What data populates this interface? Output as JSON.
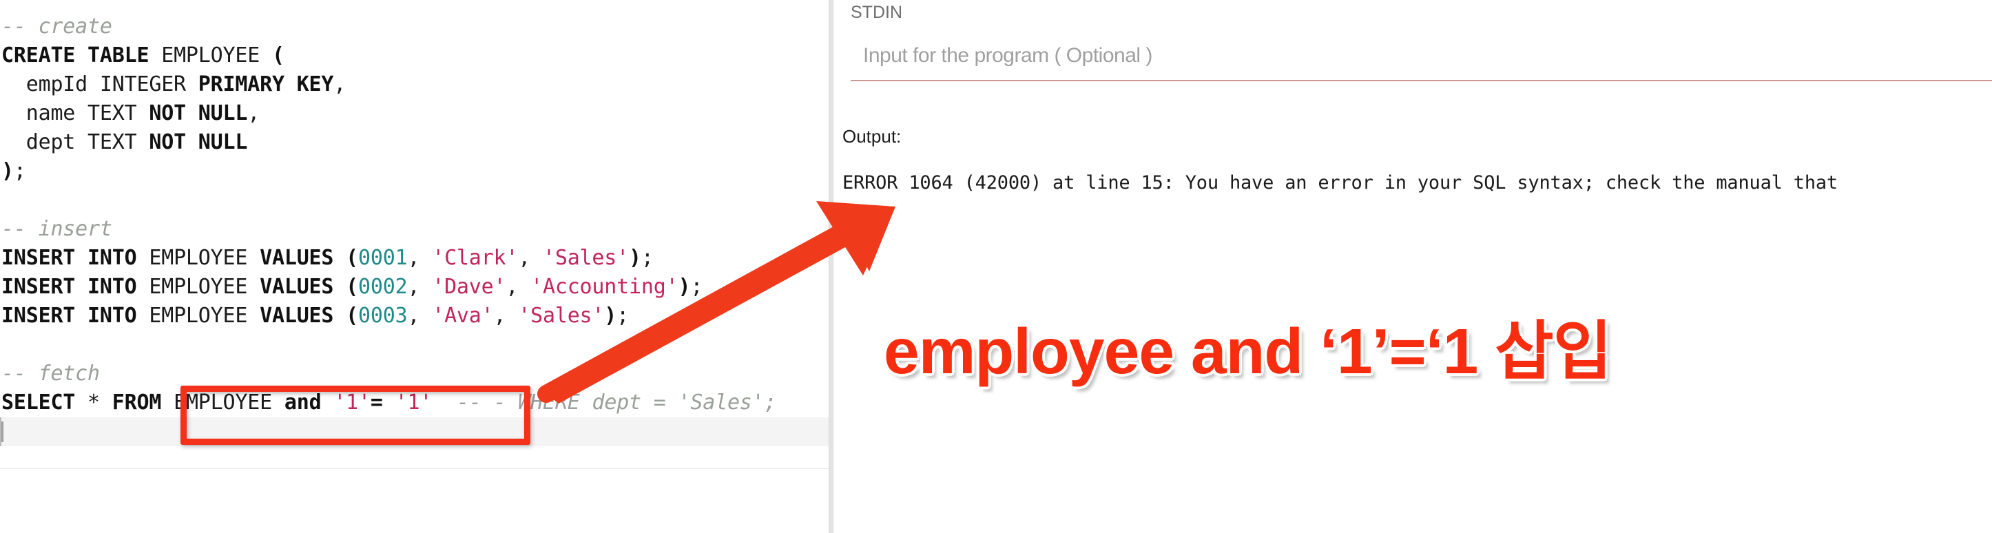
{
  "editor": {
    "lines": [
      {
        "id": "line-comment-create",
        "tokens": [
          {
            "t": "comment",
            "v": "-- create"
          }
        ]
      },
      {
        "id": "line-create-table",
        "tokens": [
          {
            "t": "kw",
            "v": "CREATE TABLE"
          },
          {
            "t": "plain",
            "v": " EMPLOYEE "
          },
          {
            "t": "kw",
            "v": "("
          }
        ]
      },
      {
        "id": "line-col-empid",
        "tokens": [
          {
            "t": "plain",
            "v": "  empId INTEGER "
          },
          {
            "t": "kw",
            "v": "PRIMARY KEY"
          },
          {
            "t": "plain",
            "v": ","
          }
        ]
      },
      {
        "id": "line-col-name",
        "tokens": [
          {
            "t": "plain",
            "v": "  name TEXT "
          },
          {
            "t": "kw",
            "v": "NOT NULL"
          },
          {
            "t": "plain",
            "v": ","
          }
        ]
      },
      {
        "id": "line-col-dept",
        "tokens": [
          {
            "t": "plain",
            "v": "  dept TEXT "
          },
          {
            "t": "kw",
            "v": "NOT NULL"
          }
        ]
      },
      {
        "id": "line-close-paren",
        "tokens": [
          {
            "t": "kw",
            "v": ")"
          },
          {
            "t": "plain",
            "v": ";"
          }
        ]
      },
      {
        "id": "line-blank-1",
        "tokens": [
          {
            "t": "plain",
            "v": " "
          }
        ]
      },
      {
        "id": "line-comment-insert",
        "tokens": [
          {
            "t": "comment",
            "v": "-- insert"
          }
        ]
      },
      {
        "id": "line-insert-1",
        "tokens": [
          {
            "t": "kw",
            "v": "INSERT INTO"
          },
          {
            "t": "plain",
            "v": " EMPLOYEE "
          },
          {
            "t": "kw",
            "v": "VALUES ("
          },
          {
            "t": "num",
            "v": "0001"
          },
          {
            "t": "plain",
            "v": ", "
          },
          {
            "t": "str",
            "v": "'Clark'"
          },
          {
            "t": "plain",
            "v": ", "
          },
          {
            "t": "str",
            "v": "'Sales'"
          },
          {
            "t": "kw",
            "v": ")"
          },
          {
            "t": "plain",
            "v": ";"
          }
        ]
      },
      {
        "id": "line-insert-2",
        "tokens": [
          {
            "t": "kw",
            "v": "INSERT INTO"
          },
          {
            "t": "plain",
            "v": " EMPLOYEE "
          },
          {
            "t": "kw",
            "v": "VALUES ("
          },
          {
            "t": "num",
            "v": "0002"
          },
          {
            "t": "plain",
            "v": ", "
          },
          {
            "t": "str",
            "v": "'Dave'"
          },
          {
            "t": "plain",
            "v": ", "
          },
          {
            "t": "str",
            "v": "'Accounting'"
          },
          {
            "t": "kw",
            "v": ")"
          },
          {
            "t": "plain",
            "v": ";"
          }
        ]
      },
      {
        "id": "line-insert-3",
        "tokens": [
          {
            "t": "kw",
            "v": "INSERT INTO"
          },
          {
            "t": "plain",
            "v": " EMPLOYEE "
          },
          {
            "t": "kw",
            "v": "VALUES ("
          },
          {
            "t": "num",
            "v": "0003"
          },
          {
            "t": "plain",
            "v": ", "
          },
          {
            "t": "str",
            "v": "'Ava'"
          },
          {
            "t": "plain",
            "v": ", "
          },
          {
            "t": "str",
            "v": "'Sales'"
          },
          {
            "t": "kw",
            "v": ")"
          },
          {
            "t": "plain",
            "v": ";"
          }
        ]
      },
      {
        "id": "line-blank-2",
        "tokens": [
          {
            "t": "plain",
            "v": " "
          }
        ]
      },
      {
        "id": "line-comment-fetch",
        "tokens": [
          {
            "t": "comment",
            "v": "-- fetch"
          }
        ]
      },
      {
        "id": "line-select",
        "tokens": [
          {
            "t": "kw",
            "v": "SELECT"
          },
          {
            "t": "plain",
            "v": " * "
          },
          {
            "t": "kw",
            "v": "FROM"
          },
          {
            "t": "plain",
            "v": " EMPLOYEE "
          },
          {
            "t": "kw",
            "v": "and"
          },
          {
            "t": "plain",
            "v": " "
          },
          {
            "t": "str",
            "v": "'1'"
          },
          {
            "t": "kw",
            "v": "="
          },
          {
            "t": "plain",
            "v": " "
          },
          {
            "t": "str",
            "v": "'1'"
          },
          {
            "t": "plain",
            "v": "  "
          },
          {
            "t": "comment",
            "v": "-- -"
          },
          {
            "t": "comment",
            "v": " WHERE dept = 'Sales';"
          }
        ]
      }
    ],
    "active_line_caret": "|"
  },
  "output_panel": {
    "stdin_label": "STDIN",
    "stdin_value": "",
    "stdin_placeholder": "Input for the program ( Optional )",
    "output_label": "Output:",
    "output_text": "ERROR 1064 (42000) at line 15: You have an error in your SQL syntax; check the manual that"
  },
  "annotations": {
    "callout_text": "employee and ‘1’=‘1 삽입",
    "highlight_box_label": "EMPLOYEE and '1'= '1' -- -",
    "arrow_label": "red-arrow-pointing-to-output"
  },
  "colors": {
    "accent_red": "#f4311a",
    "callout_red": "#f72d10",
    "string_crimson": "#c2255c",
    "number_teal": "#1f8a8a",
    "comment_grey": "#9aa09a",
    "stdin_underline": "#cd9a93"
  }
}
